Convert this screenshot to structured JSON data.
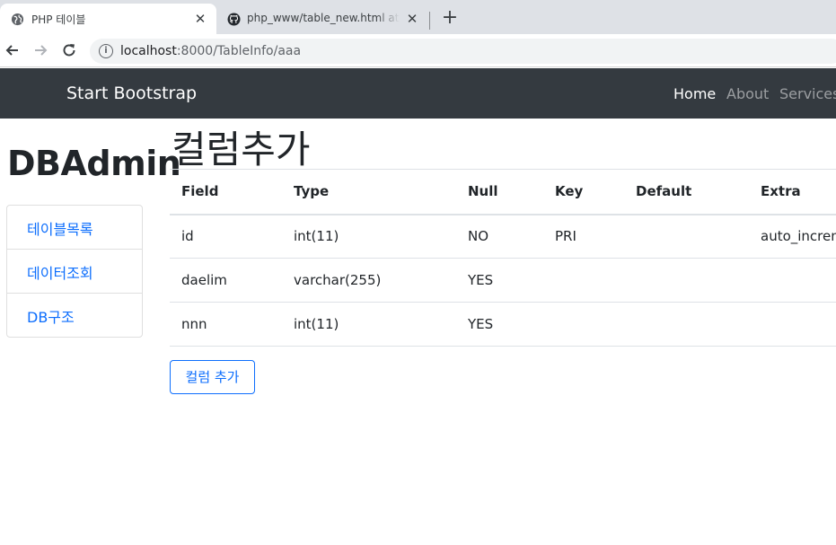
{
  "browser": {
    "tabs": [
      {
        "title": "PHP 테이블",
        "icon": "globe-icon",
        "active": true
      },
      {
        "title": "php_www/table_new.html at master",
        "icon": "github-icon",
        "active": false
      }
    ],
    "close_glyph": "✕",
    "new_tab_glyph": "+",
    "url_host": "localhost",
    "url_path": ":8000/TableInfo/aaa"
  },
  "navbar": {
    "brand": "Start Bootstrap",
    "links": [
      {
        "label": "Home",
        "active": true
      },
      {
        "label": "About",
        "active": false
      },
      {
        "label": "Services",
        "active": false
      }
    ],
    "background": "#343a40"
  },
  "sidebar": {
    "title": "DBAdmin",
    "items": [
      {
        "label": "테이블목록"
      },
      {
        "label": "데이터조회"
      },
      {
        "label": "DB구조"
      }
    ]
  },
  "main": {
    "title": "컬럼추가",
    "table": {
      "headers": [
        "Field",
        "Type",
        "Null",
        "Key",
        "Default",
        "Extra"
      ],
      "rows": [
        [
          "id",
          "int(11)",
          "NO",
          "PRI",
          "",
          "auto_increment"
        ],
        [
          "daelim",
          "varchar(255)",
          "YES",
          "",
          "",
          ""
        ],
        [
          "nnn",
          "int(11)",
          "YES",
          "",
          "",
          ""
        ]
      ]
    },
    "add_button": "컬럼 추가",
    "accent": "#0d6efd"
  }
}
